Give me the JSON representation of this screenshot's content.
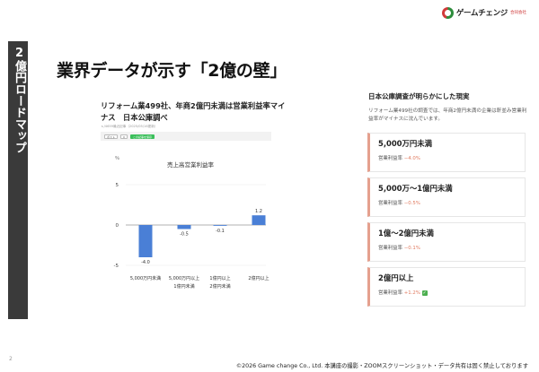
{
  "sidebar": {
    "vertical_title": "2億円ロードマップ"
  },
  "logo": {
    "name": "ゲームチェンジ",
    "sub": "合同会社"
  },
  "slide": {
    "title": "業界データが示す「2億の壁」"
  },
  "article": {
    "title": "リフォーム業499社、年商2億円未満は営業利益率マイナス　日本公庫調べ",
    "date": "ｓ/4659最近記事（2025/05/16更新）",
    "share": {
      "post": "ポスト",
      "count": "0",
      "save": "この記事を保存"
    }
  },
  "right_panel": {
    "title": "日本公庫調査が明らかにした現実",
    "description": "リフォーム業499社の調査では、年商2億円未満の企業は軒並み営業利益率がマイナスに沈んでいます。",
    "cards": [
      {
        "heading": "5,000万円未満",
        "label": "営業利益率",
        "value": "−4.0%"
      },
      {
        "heading": "5,000万〜1億円未満",
        "label": "営業利益率",
        "value": "−0.5%"
      },
      {
        "heading": "1億〜2億円未満",
        "label": "営業利益率",
        "value": "−0.1%"
      },
      {
        "heading": "2億円以上",
        "label": "営業利益率",
        "value": "+1.2%",
        "check": "✓"
      }
    ]
  },
  "chart_data": {
    "type": "bar",
    "title": "売上高営業利益率",
    "unit_label": "％",
    "categories": [
      "5,000万円未満",
      "5,000万円以上\n1億円未満",
      "1億円以上\n2億円未満",
      "2億円以上"
    ],
    "values": [
      -4.0,
      -0.5,
      -0.1,
      1.2
    ],
    "value_labels": [
      "-4.0",
      "-0.5",
      "-0.1",
      "1.2"
    ],
    "yticks": [
      "5",
      "0",
      "-5"
    ],
    "ylim": [
      -5,
      5
    ],
    "color": "#4a7fd6"
  },
  "page_number": "2",
  "footer": "©2026 Game change Co., Ltd. 本講座の撮影・ZOOMスクリーンショット・データ共有は固く禁止しております"
}
